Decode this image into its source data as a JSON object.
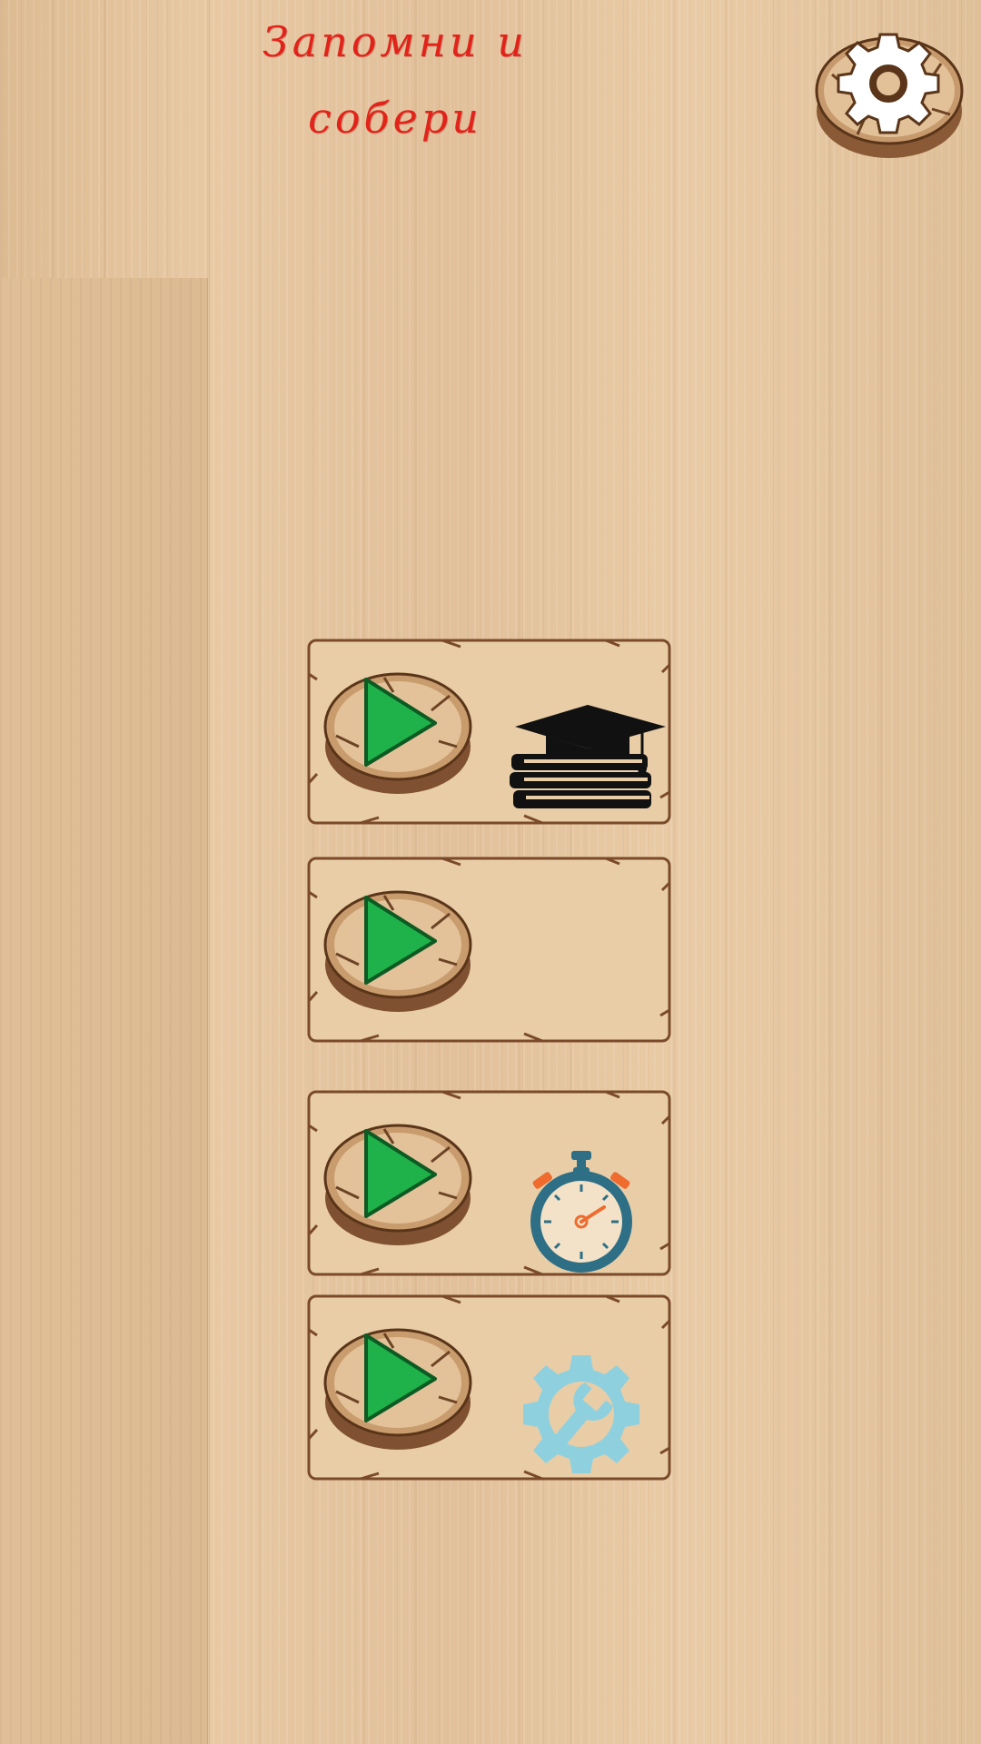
{
  "title": {
    "line1": "Запомни и",
    "line2": "собери"
  },
  "settings_button": {
    "icon": "gear-icon"
  },
  "modes": [
    {
      "play_icon": "play-icon",
      "mode_icon": "graduation-cap-books-icon"
    },
    {
      "play_icon": "play-icon",
      "mode_icon": ""
    },
    {
      "play_icon": "play-icon",
      "mode_icon": "stopwatch-icon"
    },
    {
      "play_icon": "play-icon",
      "mode_icon": "gear-wrench-icon"
    }
  ],
  "colors": {
    "title_red": "#e2231a",
    "play_green": "#1fb14a",
    "wood_dark": "#7a4a2a",
    "stopwatch_teal": "#2e6f86",
    "stopwatch_orange": "#ef6b2e",
    "wrench_gear_blue": "#8fd0df"
  }
}
